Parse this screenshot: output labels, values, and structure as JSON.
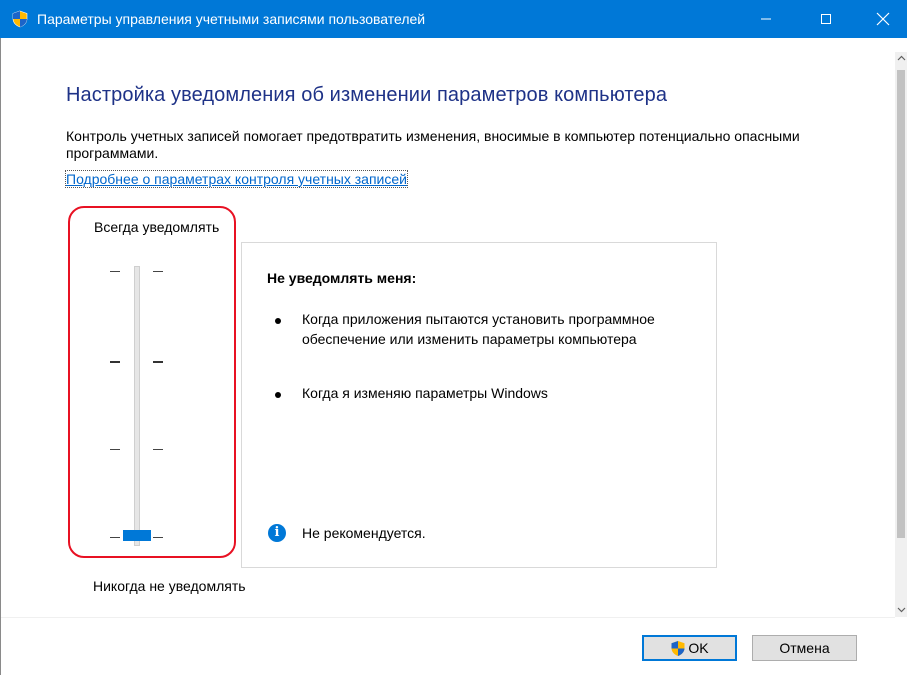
{
  "window": {
    "title": "Параметры управления учетными записями пользователей",
    "icon": "uac-shield-icon",
    "controls": {
      "minimize": "minimize-icon",
      "maximize": "maximize-icon",
      "close": "close-icon"
    }
  },
  "main": {
    "heading": "Настройка уведомления об изменении параметров компьютера",
    "description": "Контроль учетных записей помогает предотвратить изменения, вносимые в компьютер потенциально опасными программами.",
    "link": "Подробнее о параметрах контроля учетных записей"
  },
  "slider": {
    "top_label": "Всегда уведомлять",
    "bottom_label": "Никогда не уведомлять",
    "levels": 4,
    "selected_level": 1,
    "accent": "#0078d7",
    "highlight_color": "#e81123"
  },
  "panel": {
    "title": "Не уведомлять меня:",
    "bullets": [
      "Когда приложения пытаются установить программное обеспечение или изменить параметры компьютера",
      "Когда я изменяю параметры Windows"
    ],
    "note": "Не рекомендуется.",
    "note_icon": "info-icon"
  },
  "buttons": {
    "ok": "OK",
    "cancel": "Отмена"
  },
  "colors": {
    "titlebar": "#0078d7",
    "heading": "#1e3287",
    "link": "#0066cc"
  }
}
